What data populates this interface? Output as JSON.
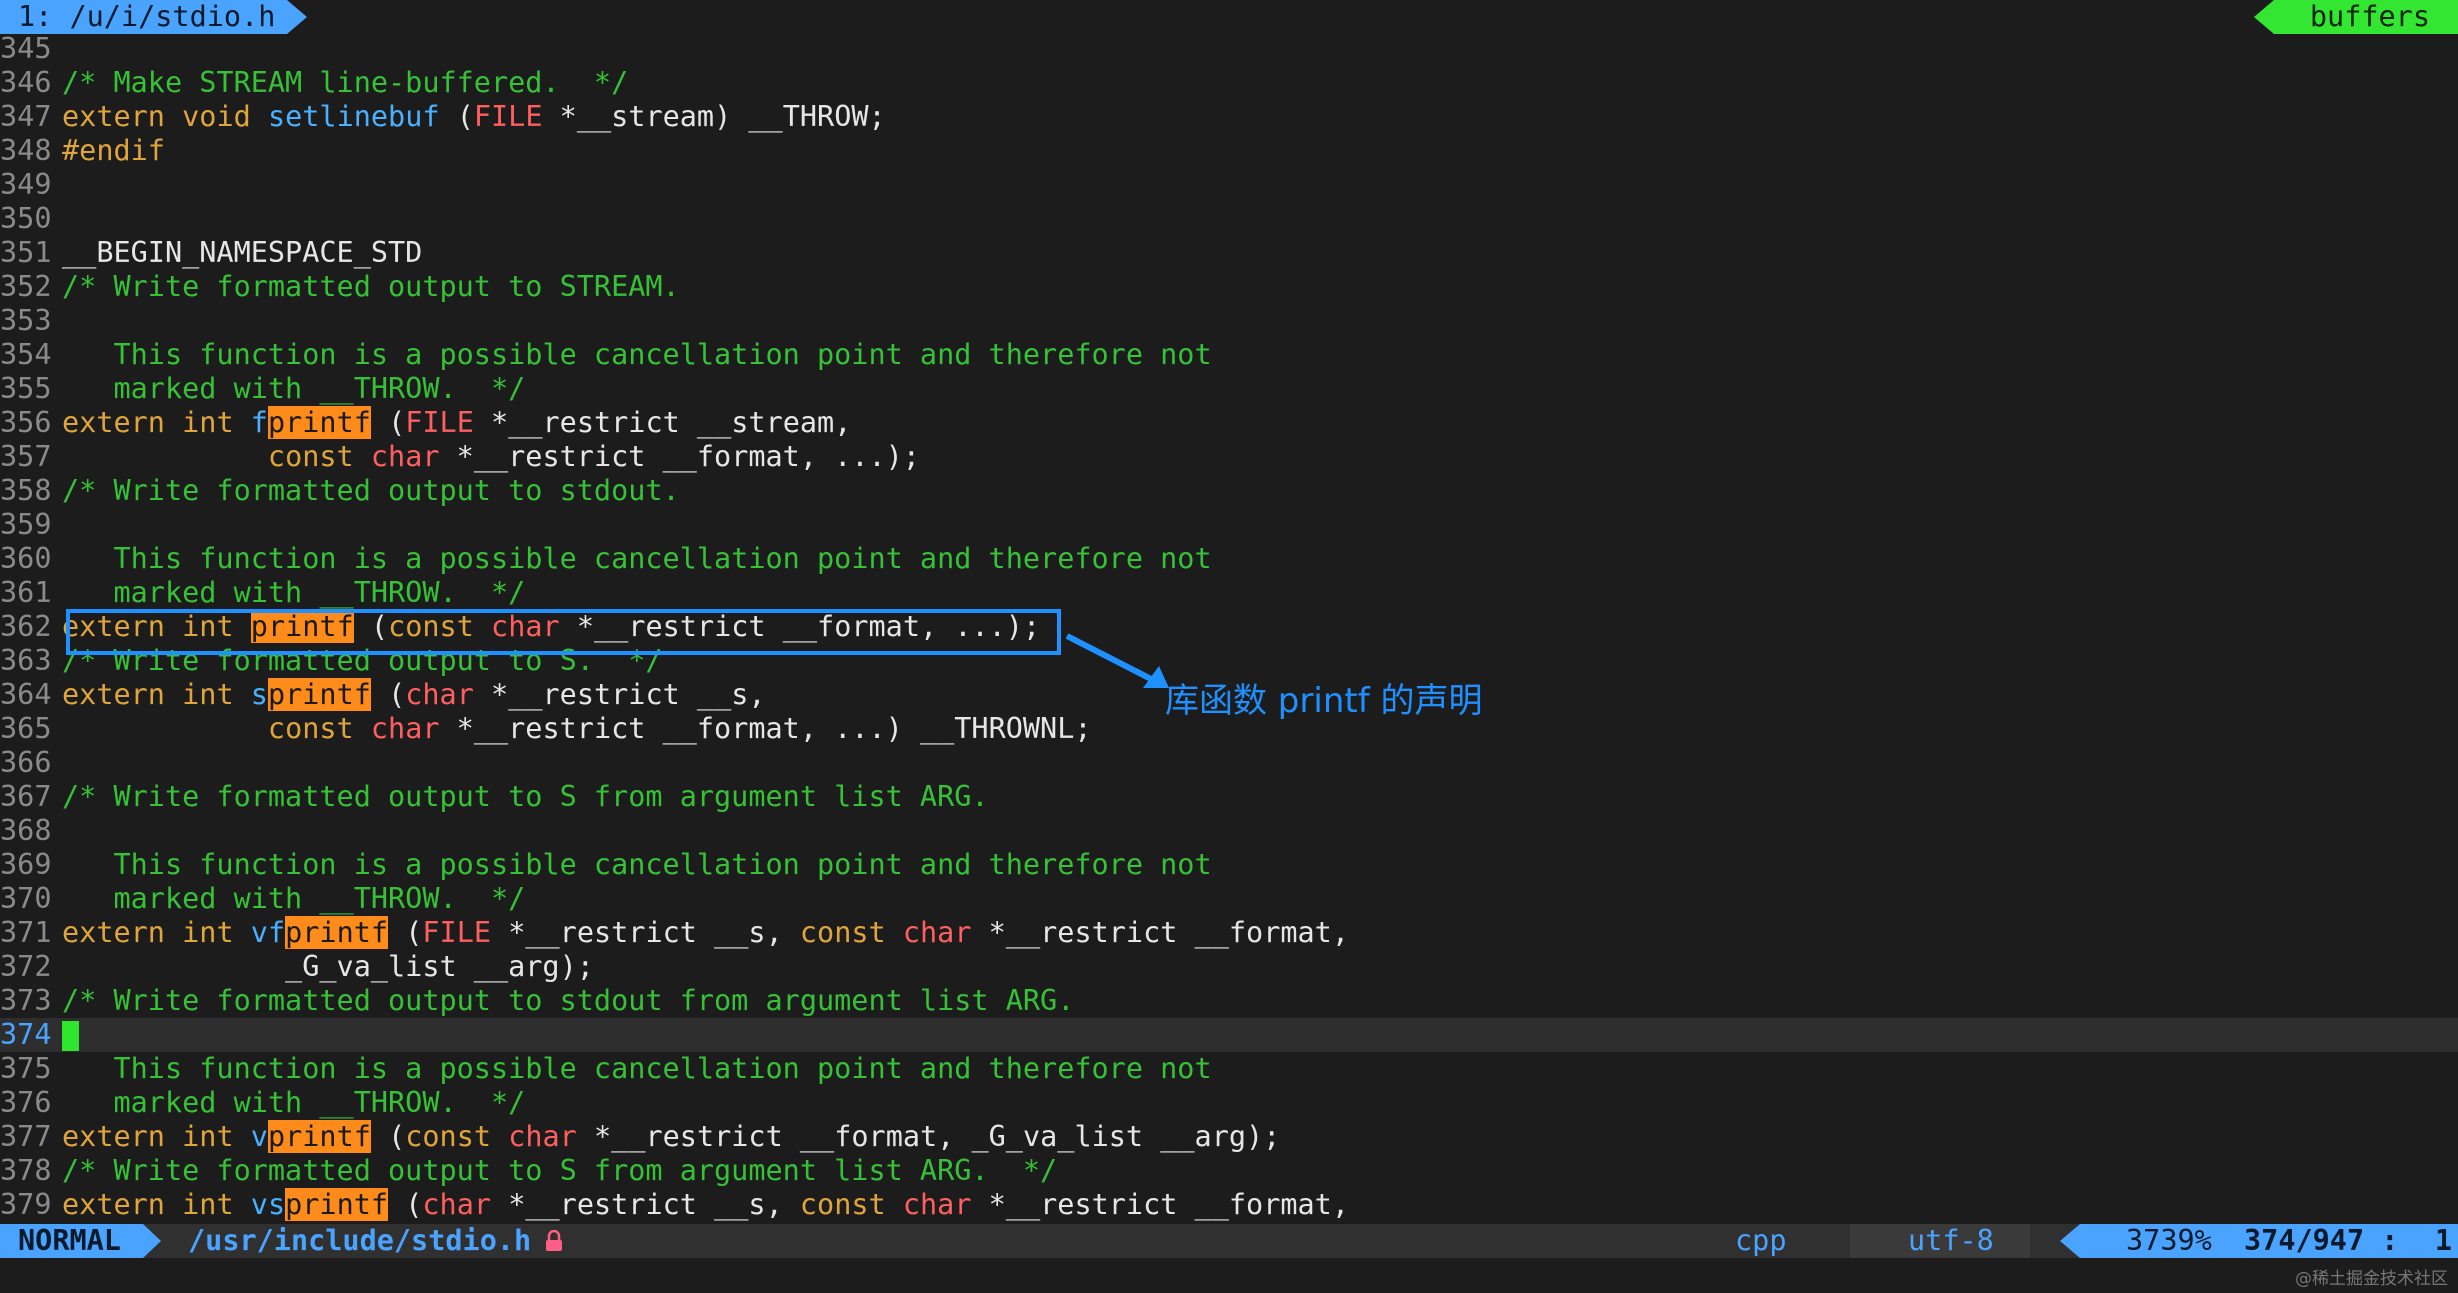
{
  "tabline": {
    "tab_label": "1: /u/i/stdio.h",
    "buffers_label": "buffers"
  },
  "code_lines": [
    {
      "num": "345"
    },
    {
      "num": "346"
    },
    {
      "num": "347"
    },
    {
      "num": "348"
    },
    {
      "num": "349"
    },
    {
      "num": "350"
    },
    {
      "num": "351"
    },
    {
      "num": "352"
    },
    {
      "num": "353"
    },
    {
      "num": "354"
    },
    {
      "num": "355"
    },
    {
      "num": "356"
    },
    {
      "num": "357"
    },
    {
      "num": "358"
    },
    {
      "num": "359"
    },
    {
      "num": "360"
    },
    {
      "num": "361"
    },
    {
      "num": "362"
    },
    {
      "num": "363"
    },
    {
      "num": "364"
    },
    {
      "num": "365"
    },
    {
      "num": "366"
    },
    {
      "num": "367"
    },
    {
      "num": "368"
    },
    {
      "num": "369"
    },
    {
      "num": "370"
    },
    {
      "num": "371"
    },
    {
      "num": "372"
    },
    {
      "num": "373"
    },
    {
      "num": "374"
    },
    {
      "num": "375"
    },
    {
      "num": "376"
    },
    {
      "num": "377"
    },
    {
      "num": "378"
    },
    {
      "num": "379"
    }
  ],
  "code": {
    "l346": "/* Make STREAM line-buffered.  */",
    "l347_extern": "extern",
    "l347_void": "void",
    "l347_fn": "setlinebuf",
    "l347_rest1": " (",
    "l347_type": "FILE",
    "l347_rest2": " *__stream) __THROW;",
    "l348": "#endif",
    "l351": "__BEGIN_NAMESPACE_STD",
    "l352": "/* Write formatted output to STREAM.",
    "l354": "   This function is a possible cancellation point and therefore not",
    "l355": "   marked with __THROW.  */",
    "l356_pre": "f",
    "l356_hl": "printf",
    "l356_type": "FILE",
    "l356_rest": " *__restrict __stream,",
    "l357_const": "const",
    "l357_char": "char",
    "l357_rest": " *__restrict __format, ...);",
    "l358": "/* Write formatted output to stdout.",
    "l360": "   This function is a possible cancellation point and therefore not",
    "l361": "   marked with __THROW.  */",
    "l362_hl": "printf",
    "l362_rest": " *__restrict __format, ...);",
    "l363": "/* Write formatted output to S.  */",
    "l364_pre": "s",
    "l364_hl": "printf",
    "l364_char": "char",
    "l364_rest": " *__restrict __s,",
    "l365_rest": " *__restrict __format, ...) __THROWNL;",
    "l367": "/* Write formatted output to S from argument list ARG.",
    "l369": "   This function is a possible cancellation point and therefore not",
    "l370": "   marked with __THROW.  */",
    "l371_pre": "vf",
    "l371_hl": "printf",
    "l371_type": "FILE",
    "l371_rest1": " *__restrict __s, ",
    "l371_rest2": " *__restrict __format,",
    "l372": "             _G_va_list __arg);",
    "l373": "/* Write formatted output to stdout from argument list ARG.",
    "l375": "   This function is a possible cancellation point and therefore not",
    "l376": "   marked with __THROW.  */",
    "l377_pre": "v",
    "l377_hl": "printf",
    "l377_rest": " *__restrict __format, _G_va_list __arg);",
    "l378": "/* Write formatted output to S from argument list ARG.  */",
    "l379_pre": "vs",
    "l379_hl": "printf",
    "l379_rest1": " *__restrict __s, ",
    "l379_rest2": " *__restrict __format,",
    "kw_extern": "extern",
    "kw_int": "int",
    "kw_const": "const",
    "kw_char": "char"
  },
  "annotation": {
    "label": "库函数 printf 的声明"
  },
  "statusline": {
    "mode": "NORMAL",
    "path": "/usr/include/stdio.h",
    "filetype": "cpp",
    "encoding": "utf-8",
    "percent": "3739%",
    "line_count": "374/947",
    "sep": ":",
    "column": "1"
  },
  "watermark": "@稀土掘金技术社区",
  "colors": {
    "accent": "#4aa3ff",
    "comment": "#36c136",
    "highlight": "#ff8c1a",
    "annotation": "#1e90ff"
  }
}
